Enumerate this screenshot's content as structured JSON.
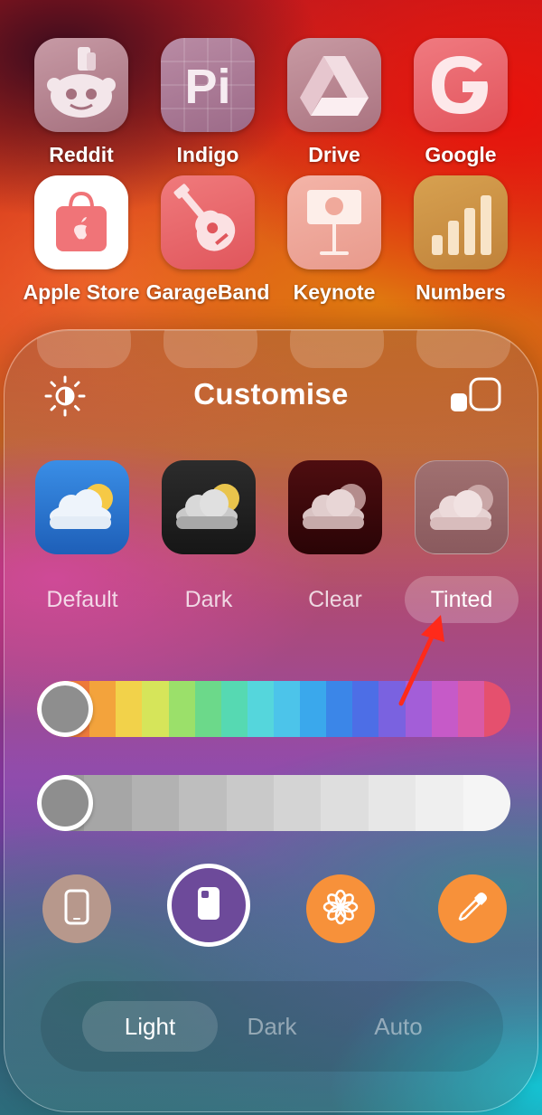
{
  "home_apps": [
    {
      "name": "Reddit"
    },
    {
      "name": "Indigo"
    },
    {
      "name": "Drive"
    },
    {
      "name": "Google"
    },
    {
      "name": "Apple Store"
    },
    {
      "name": "GarageBand"
    },
    {
      "name": "Keynote"
    },
    {
      "name": "Numbers"
    }
  ],
  "sheet": {
    "title": "Customise",
    "styles": [
      {
        "label": "Default"
      },
      {
        "label": "Dark"
      },
      {
        "label": "Clear"
      },
      {
        "label": "Tinted"
      }
    ],
    "selected_style": "Tinted",
    "hue_slider_value": 0,
    "saturation_slider_value": 0,
    "tools": [
      "phone-icon",
      "phone-back-icon",
      "flower-icon",
      "eyedropper-icon"
    ],
    "modes": [
      {
        "label": "Light"
      },
      {
        "label": "Dark"
      },
      {
        "label": "Auto"
      }
    ],
    "selected_mode": "Light"
  },
  "colors": {
    "annotation_arrow": "#ff2a1a",
    "tool_flower_bg": "#f7913a",
    "tool_eyedropper_bg": "#f7913a",
    "tool_selected_bg": "#6d4a9a"
  }
}
